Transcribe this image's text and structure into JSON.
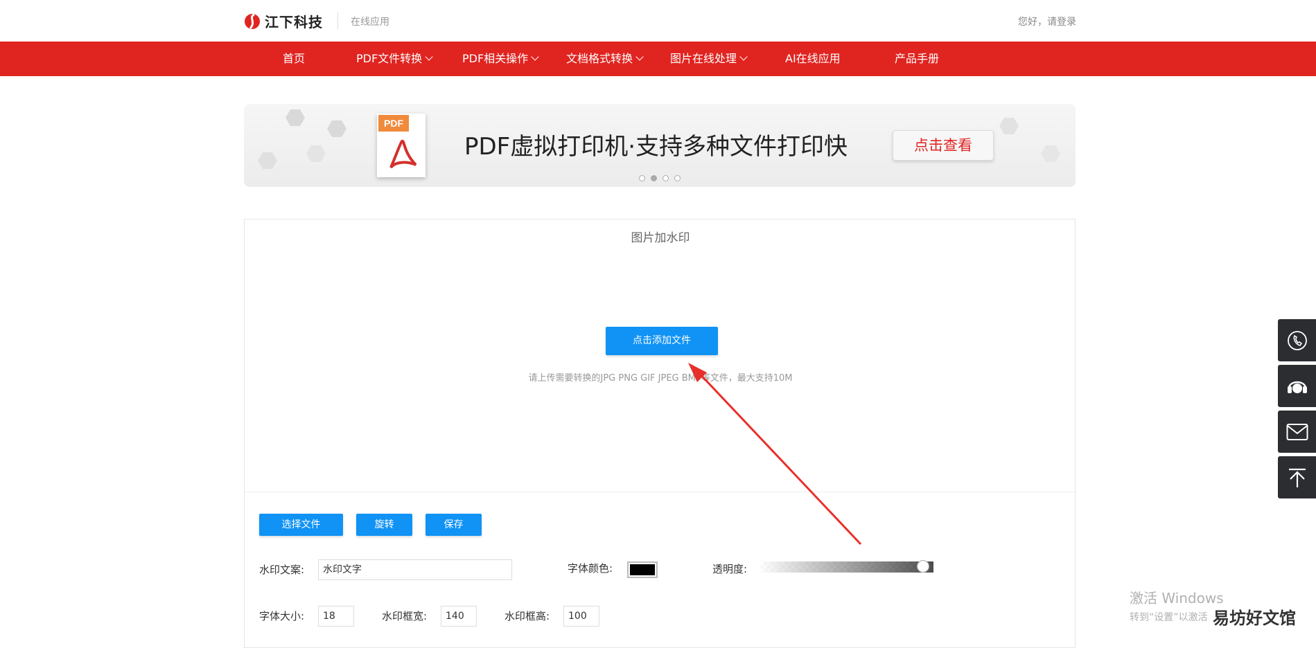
{
  "header": {
    "brand": "江下科技",
    "sub": "在线应用",
    "login": "您好，请登录"
  },
  "nav": {
    "items": [
      {
        "label": "首页",
        "dropdown": false
      },
      {
        "label": "PDF文件转换",
        "dropdown": true
      },
      {
        "label": "PDF相关操作",
        "dropdown": true
      },
      {
        "label": "文档格式转换",
        "dropdown": true
      },
      {
        "label": "图片在线处理",
        "dropdown": true
      },
      {
        "label": "AI在线应用",
        "dropdown": false
      },
      {
        "label": "产品手册",
        "dropdown": false
      }
    ]
  },
  "banner": {
    "pdf_tag": "PDF",
    "title": "PDF虚拟打印机·支持多种文件打印快",
    "button": "点击查看",
    "slides": 4,
    "active_slide": 2
  },
  "panel": {
    "title": "图片加水印",
    "add_button": "点击添加文件",
    "hint": "请上传需要转换的JPG PNG GIF JPEG BMP等文件，最大支持10M",
    "toolbar": {
      "select": "选择文件",
      "rotate": "旋转",
      "save": "保存"
    },
    "fields": {
      "watermark_text_label": "水印文案:",
      "watermark_text_value": "水印文字",
      "font_color_label": "字体颜色:",
      "font_color": "#000000",
      "opacity_label": "透明度:",
      "opacity": 1.0,
      "font_size_label": "字体大小:",
      "font_size_value": "18",
      "box_width_label": "水印框宽:",
      "box_width_value": "140",
      "box_height_label": "水印框高:",
      "box_height_value": "100"
    }
  },
  "sidebar": {
    "icons": [
      "phone-icon",
      "headset-icon",
      "mail-icon",
      "back-to-top-icon"
    ]
  },
  "overlay": {
    "windows_title": "激活 Windows",
    "windows_sub": "转到“设置”以激活",
    "corner_text": "易坊好文馆"
  },
  "colors": {
    "brand_red": "#e02420",
    "button_blue": "#1093f5",
    "side_dark": "#2b2d30"
  }
}
